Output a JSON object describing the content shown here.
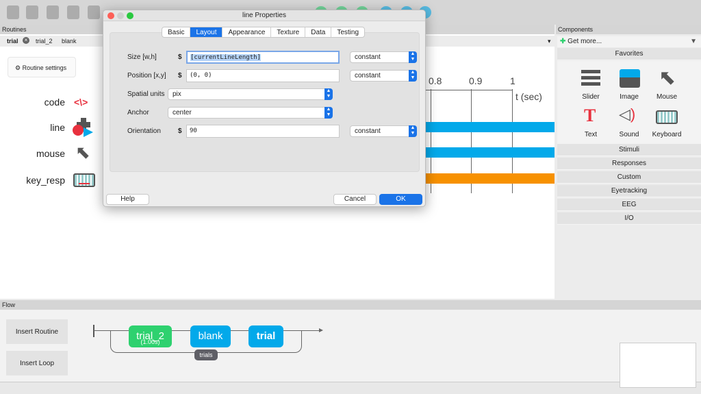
{
  "routines": {
    "header": "Routines",
    "tabs": [
      "trial",
      "trial_2",
      "blank"
    ],
    "settings_label": "Routine settings",
    "components": [
      {
        "name": "code",
        "icon": "code-icon"
      },
      {
        "name": "line",
        "icon": "line-shape-icon"
      },
      {
        "name": "mouse",
        "icon": "mouse-cursor-icon"
      },
      {
        "name": "key_resp",
        "icon": "keyboard-icon"
      }
    ],
    "timeline": {
      "ticks": [
        "0.8",
        "0.9",
        "1"
      ],
      "axis_label": "t (sec)"
    },
    "colors": {
      "visual": "#02a9ea",
      "response": "#f79100"
    }
  },
  "components_panel": {
    "header": "Components",
    "get_more": "Get more...",
    "favorites_label": "Favorites",
    "favorites": [
      "Slider",
      "Image",
      "Mouse",
      "Text",
      "Sound",
      "Keyboard"
    ],
    "categories": [
      "Stimuli",
      "Responses",
      "Custom",
      "Eyetracking",
      "EEG",
      "I/O"
    ]
  },
  "flow": {
    "header": "Flow",
    "insert_routine": "Insert Routine",
    "insert_loop": "Insert Loop",
    "routines": [
      {
        "name": "trial_2",
        "duration": "(1.00s)",
        "color": "#2ed16f"
      },
      {
        "name": "blank",
        "color": "#02a9ea"
      },
      {
        "name": "trial",
        "color": "#02a9ea"
      }
    ],
    "loop": "trials"
  },
  "dialog": {
    "title": "line Properties",
    "tabs": [
      "Basic",
      "Layout",
      "Appearance",
      "Texture",
      "Data",
      "Testing"
    ],
    "active_tab": "Layout",
    "fields": {
      "size_label": "Size [w,h]",
      "size_value": "[currentLineLength]",
      "size_mode": "constant",
      "pos_label": "Position [x,y]",
      "pos_value": "(0, 0)",
      "pos_mode": "constant",
      "units_label": "Spatial units",
      "units_value": "pix",
      "anchor_label": "Anchor",
      "anchor_value": "center",
      "ori_label": "Orientation",
      "ori_value": "90",
      "ori_mode": "constant",
      "dollar": "$"
    },
    "help": "Help",
    "cancel": "Cancel",
    "ok": "OK"
  }
}
